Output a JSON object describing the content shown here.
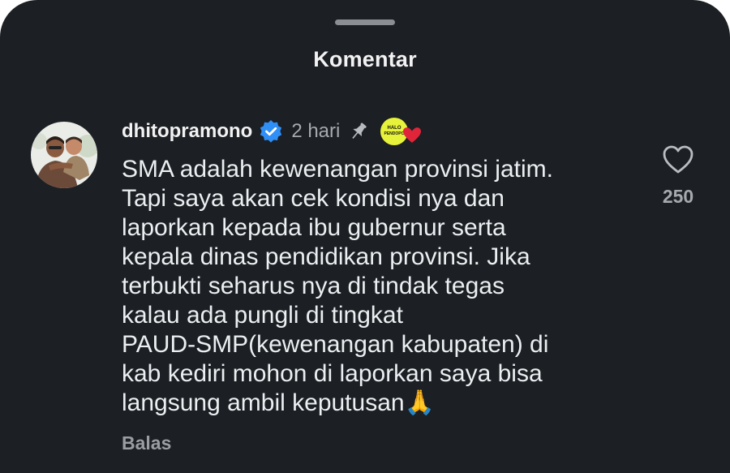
{
  "sheet": {
    "title": "Komentar"
  },
  "comment": {
    "avatar_icon": "user-avatar-photo",
    "username": "dhitopramono",
    "verified_icon": "verified-badge-icon",
    "timestamp": "2 hari",
    "pinned_icon": "pin-icon",
    "reaction_badge_text": "HALO PENDOPO",
    "reaction_heart_icon": "heart-badge-icon",
    "body_lines": [
      "SMA adalah kewenangan provinsi jatim.",
      "Tapi saya akan cek kondisi nya dan",
      "laporkan kepada ibu gubernur serta",
      "kepala dinas pendidikan provinsi. Jika",
      "terbukti seharus nya di tindak tegas",
      "kalau ada pungli di tingkat",
      "PAUD-SMP(kewenangan kabupaten) di",
      "kab kediri mohon di laporkan saya bisa",
      "langsung ambil keputusan🙏"
    ],
    "reply_label": "Balas",
    "like_icon": "heart-outline-icon",
    "like_count": "250"
  },
  "colors": {
    "background": "#1c1f23",
    "text_primary": "#f2f2f2",
    "text_secondary": "#a6a9ad",
    "verified_blue": "#2f8ff7",
    "badge_yellow": "#e7f23a",
    "heart_red": "#e0243a"
  }
}
